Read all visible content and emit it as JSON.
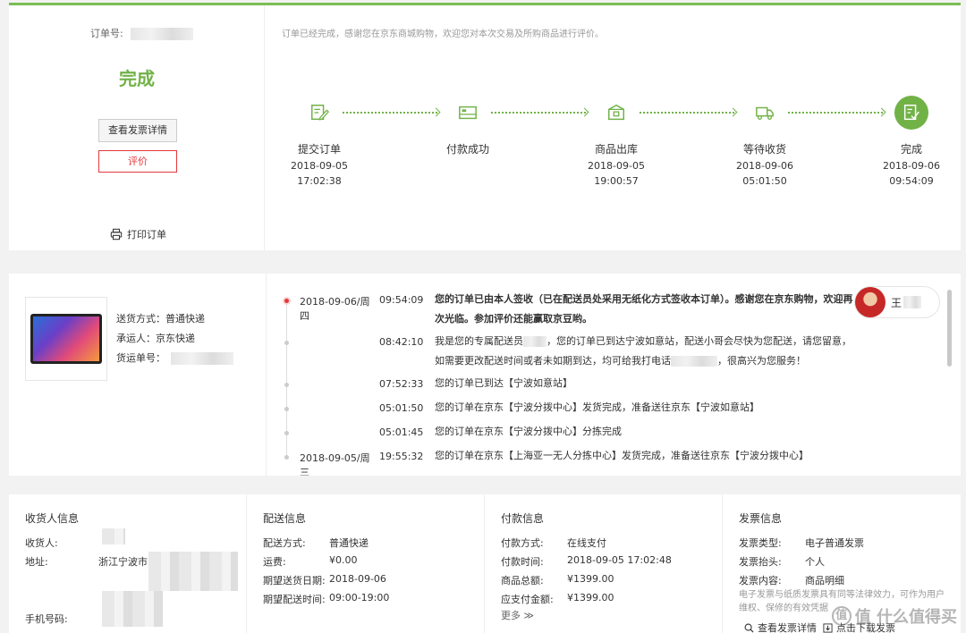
{
  "order": {
    "number_label": "订单号:",
    "status": "完成",
    "btn_invoice": "查看发票详情",
    "btn_review": "评价",
    "print_label": "打印订单",
    "thanks": "订单已经完成，感谢您在京东商城购物，欢迎您对本次交易及所购商品进行评价。",
    "steps": [
      {
        "name": "提交订单",
        "date": "2018-09-05",
        "time": "17:02:38",
        "icon": "edit-order-icon"
      },
      {
        "name": "付款成功",
        "date": "",
        "time": "",
        "icon": "card-icon"
      },
      {
        "name": "商品出库",
        "date": "2018-09-05",
        "time": "19:00:57",
        "icon": "package-icon"
      },
      {
        "name": "等待收货",
        "date": "2018-09-06",
        "time": "05:01:50",
        "icon": "truck-icon"
      },
      {
        "name": "完成",
        "date": "2018-09-06",
        "time": "09:54:09",
        "icon": "done-icon"
      }
    ],
    "accent_color": "#71b247",
    "review_color": "#e4393c"
  },
  "shipping": {
    "method_label": "送货方式：",
    "method_value": "普通快递",
    "carrier_label": "承运人：",
    "carrier_value": "京东快递",
    "waybill_label": "货运单号：",
    "courier_name": "王",
    "tracking": [
      {
        "day": "2018-09-06/周四",
        "time": "09:54:09",
        "msg": "您的订单已由本人签收（已在配送员处采用无纸化方式签收本订单）。感谢您在京东购物，欢迎再次光临。参加评价还能赢取京豆哟。",
        "active": true
      },
      {
        "day": "",
        "time": "08:42:10",
        "msg_a": "我是您的专属配送员",
        "msg_b": "，您的订单已到达宁波如意站，配送小哥会尽快为您配送，请您留意，如需要更改配送时间或者未如期到达，均可给我打电话",
        "msg_c": "，很高兴为您服务！"
      },
      {
        "day": "",
        "time": "07:52:33",
        "msg": "您的订单已到达【宁波如意站】"
      },
      {
        "day": "",
        "time": "05:01:50",
        "msg": "您的订单在京东【宁波分拨中心】发货完成，准备送往京东【宁波如意站】"
      },
      {
        "day": "",
        "time": "05:01:45",
        "msg": "您的订单在京东【宁波分拨中心】分拣完成"
      },
      {
        "day": "2018-09-05/周三",
        "time": "19:55:32",
        "msg": "您的订单在京东【上海亚一无人分拣中心】发货完成，准备送往京东【宁波分拨中心】"
      }
    ]
  },
  "info": {
    "consignee": {
      "title": "收货人信息",
      "name_label": "收货人:",
      "address_label": "地址:",
      "address_value": "浙江宁波市",
      "phone_label": "手机号码:"
    },
    "delivery": {
      "title": "配送信息",
      "rows": [
        {
          "k": "配送方式:",
          "v": "普通快递"
        },
        {
          "k": "运费:",
          "v": "¥0.00"
        },
        {
          "k": "期望送货日期:",
          "v": "2018-09-06"
        },
        {
          "k": "期望配送时间:",
          "v": "09:00-19:00"
        }
      ]
    },
    "payment": {
      "title": "付款信息",
      "rows": [
        {
          "k": "付款方式:",
          "v": "在线支付"
        },
        {
          "k": "付款时间:",
          "v": "2018-09-05 17:02:48"
        },
        {
          "k": "商品总额:",
          "v": "¥1399.00"
        },
        {
          "k": "应支付金额:",
          "v": "¥1399.00"
        }
      ],
      "more": "更多 ≫"
    },
    "invoice": {
      "title": "发票信息",
      "rows": [
        {
          "k": "发票类型:",
          "v": "电子普通发票"
        },
        {
          "k": "发票抬头:",
          "v": "个人"
        },
        {
          "k": "发票内容:",
          "v": "商品明细"
        }
      ],
      "note": "电子发票与纸质发票具有同等法律效力，可作为用户维权、保修的有效凭据",
      "link_view": "查看发票详情",
      "link_download": "点击下载发票"
    }
  },
  "watermark": "值 什么值得买"
}
